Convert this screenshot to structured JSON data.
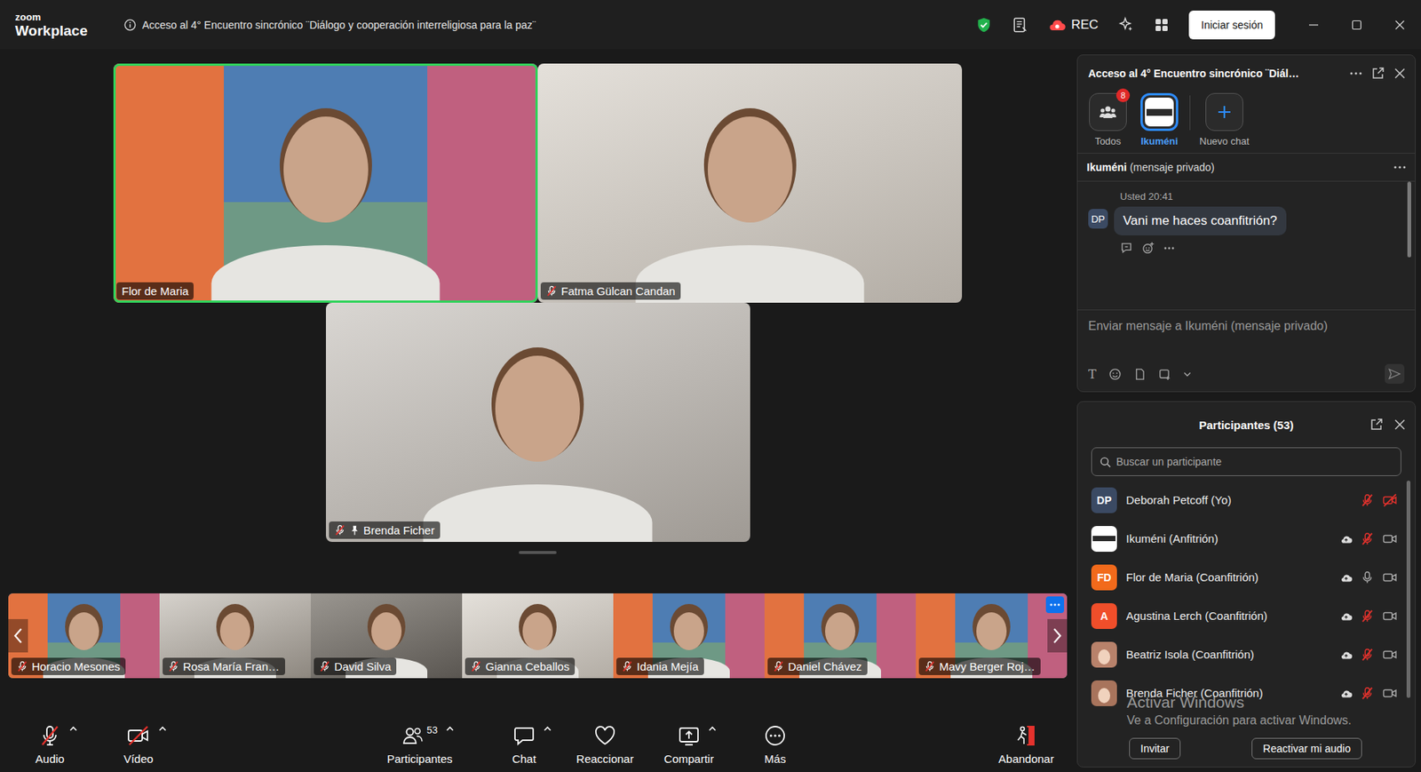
{
  "window": {
    "title": "Acceso al 4° Encuentro sincrónico ¨Diálogo y cooperación interreligiosa para la paz¨"
  },
  "app": {
    "brand_small": "zoom",
    "brand": "Workplace"
  },
  "titlebar": {
    "rec": "REC",
    "sign_in": "Iniciar sesión"
  },
  "stage": {
    "tiles": [
      {
        "name": "Flor de Maria",
        "muted": false,
        "pinned": false,
        "active_speaker": true,
        "kind": "virtual"
      },
      {
        "name": "Fatma Gülcan Candan",
        "muted": true,
        "pinned": false,
        "active_speaker": false,
        "kind": "camera"
      },
      {
        "name": "Brenda Ficher",
        "muted": true,
        "pinned": true,
        "active_speaker": false,
        "kind": "camera"
      }
    ],
    "thumbnails": [
      {
        "name": "Horacio Mesones",
        "muted": true,
        "kind": "virtual",
        "options": false
      },
      {
        "name": "Rosa María Fran…",
        "muted": true,
        "kind": "camera",
        "options": false
      },
      {
        "name": "David Silva",
        "muted": true,
        "kind": "camera",
        "options": false
      },
      {
        "name": "Gianna Ceballos",
        "muted": true,
        "kind": "camera",
        "options": false
      },
      {
        "name": "Idania Mejía",
        "muted": true,
        "kind": "virtual",
        "options": false
      },
      {
        "name": "Daniel Chávez",
        "muted": true,
        "kind": "virtual",
        "options": false
      },
      {
        "name": "Mavy Berger Roj…",
        "muted": true,
        "kind": "virtual",
        "options": true
      }
    ]
  },
  "toolbar": {
    "audio": {
      "label": "Audio",
      "off": true
    },
    "video": {
      "label": "Vídeo",
      "off": true
    },
    "participants": {
      "label": "Participantes",
      "count": "53"
    },
    "chat": {
      "label": "Chat"
    },
    "react": {
      "label": "Reaccionar"
    },
    "share": {
      "label": "Compartir"
    },
    "more": {
      "label": "Más"
    },
    "leave": {
      "label": "Abandonar"
    }
  },
  "chat": {
    "title": "Acceso al 4° Encuentro sincrónico ¨Diál…",
    "tabs": [
      {
        "label": "Todos",
        "kind": "group",
        "badge": "8",
        "selected": false
      },
      {
        "label": "Ikuméni",
        "kind": "contact",
        "selected": true
      },
      {
        "label": "Nuevo chat",
        "kind": "new",
        "selected": false
      }
    ],
    "conversation": {
      "name": "Ikuméni",
      "note": "(mensaje privado)"
    },
    "messages": [
      {
        "initials": "DP",
        "sender": "Usted",
        "time": "20:41",
        "text": "Vani me haces coanfitrión?"
      }
    ],
    "input": {
      "placeholder": "Enviar mensaje a Ikuméni (mensaje privado)",
      "format_glyph": "T"
    }
  },
  "participants": {
    "title": "Participantes (53)",
    "search_placeholder": "Buscar un participante",
    "list": [
      {
        "name": "Deborah Petcoff (Yo)",
        "kind": "initials",
        "initials": "DP",
        "color": "#3b4a63",
        "cloud": false,
        "muted": true,
        "video_off": true
      },
      {
        "name": "Ikuméni (Anfitrión)",
        "kind": "logo",
        "color": "#ffffff",
        "cloud": true,
        "muted": true,
        "video_off": false
      },
      {
        "name": "Flor de Maria (Coanfitrión)",
        "kind": "initials",
        "initials": "FD",
        "color": "#f26a1b",
        "cloud": true,
        "muted": false,
        "video_off": false
      },
      {
        "name": "Agustina Lerch (Coanfitrión)",
        "kind": "initials",
        "initials": "A",
        "color": "#f04e2a",
        "cloud": true,
        "muted": true,
        "video_off": false
      },
      {
        "name": "Beatriz Isola (Coanfitrión)",
        "kind": "photo",
        "color": "#b8826b",
        "cloud": true,
        "muted": true,
        "video_off": false
      },
      {
        "name": "Brenda Ficher (Coanfitrión)",
        "kind": "photo",
        "color": "#a8745c",
        "cloud": true,
        "muted": true,
        "video_off": false
      }
    ],
    "buttons": [
      "Invitar",
      "Reactivar mi audio"
    ]
  },
  "watermark": {
    "title": "Activar Windows",
    "text": "Ve a Configuración para activar Windows."
  }
}
